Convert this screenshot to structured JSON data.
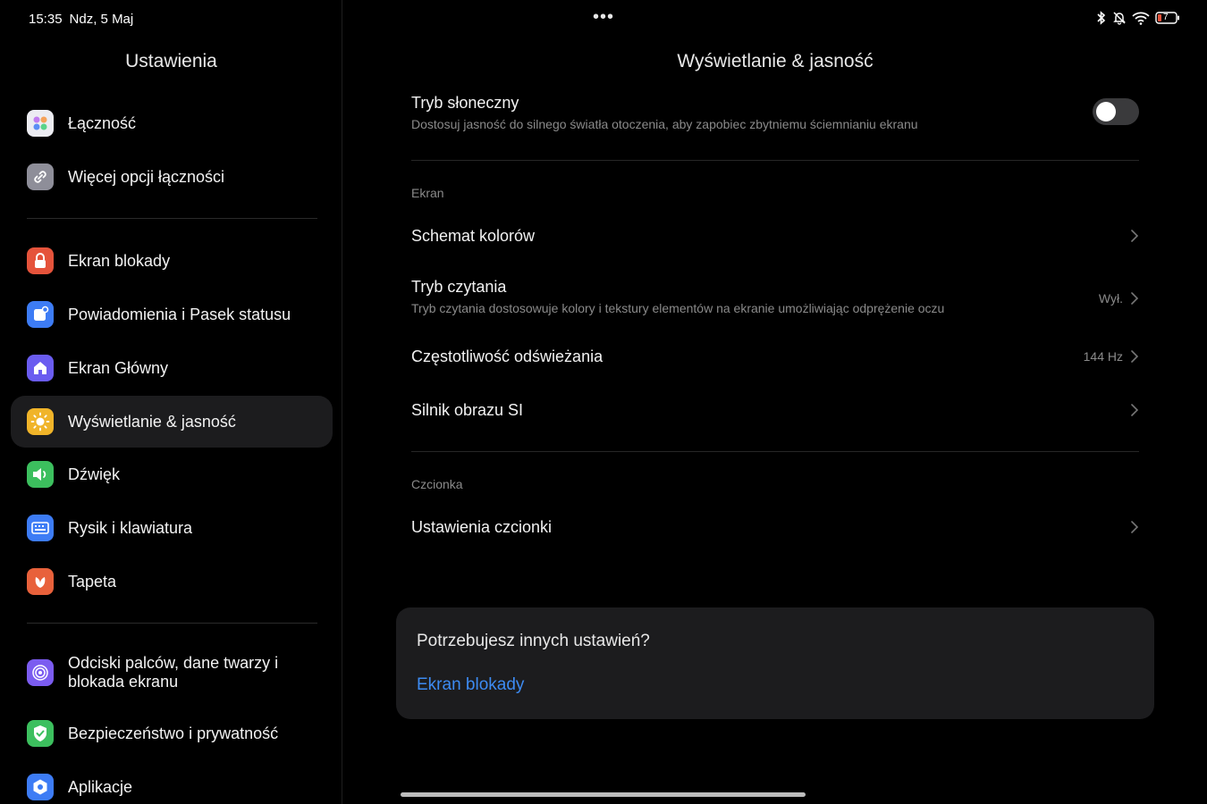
{
  "status_bar": {
    "time": "15:35",
    "date": "Ndz, 5 Maj",
    "more": "•••",
    "battery_level": "7"
  },
  "sidebar": {
    "title": "Ustawienia",
    "items": [
      {
        "label": "Łączność",
        "icon": "connectivity-icon",
        "color": "#e8e8ee"
      },
      {
        "label": "Więcej opcji łączności",
        "icon": "link-icon",
        "color": "#8e8e99"
      },
      {
        "label": "Ekran blokady",
        "icon": "lock-icon",
        "color": "#e5533b"
      },
      {
        "label": "Powiadomienia i Pasek statusu",
        "icon": "notification-icon",
        "color": "#3d7cf5"
      },
      {
        "label": "Ekran Główny",
        "icon": "home-icon",
        "color": "#6a5cf0"
      },
      {
        "label": "Wyświetlanie & jasność",
        "icon": "sun-icon",
        "color": "#f0b429",
        "active": true
      },
      {
        "label": "Dźwięk",
        "icon": "speaker-icon",
        "color": "#3cbf5e"
      },
      {
        "label": "Rysik i klawiatura",
        "icon": "keyboard-icon",
        "color": "#3d7cf5"
      },
      {
        "label": "Tapeta",
        "icon": "wallpaper-icon",
        "color": "#e8613b"
      },
      {
        "label": "Odciski palców, dane twarzy i blokada ekranu",
        "icon": "fingerprint-icon",
        "color": "#7b5cf0"
      },
      {
        "label": "Bezpieczeństwo i prywatność",
        "icon": "shield-icon",
        "color": "#3cbf5e"
      },
      {
        "label": "Aplikacje",
        "icon": "apps-icon",
        "color": "#3d7cf5"
      }
    ]
  },
  "main": {
    "title": "Wyświetlanie & jasność",
    "sun_mode": {
      "title": "Tryb słoneczny",
      "subtitle": "Dostosuj jasność do silnego światła otoczenia, aby zapobiec zbytniemu ściemnianiu ekranu",
      "enabled": false
    },
    "section_screen": "Ekran",
    "color_scheme": {
      "title": "Schemat kolorów"
    },
    "reading_mode": {
      "title": "Tryb czytania",
      "subtitle": "Tryb czytania dostosowuje kolory i tekstury elementów na ekranie umożliwiając odprężenie oczu",
      "value": "Wył."
    },
    "refresh_rate": {
      "title": "Częstotliwość odświeżania",
      "value": "144 Hz"
    },
    "ai_engine": {
      "title": "Silnik obrazu SI"
    },
    "section_font": "Czcionka",
    "font_settings": {
      "title": "Ustawienia czcionki"
    },
    "card": {
      "title": "Potrzebujesz innych ustawień?",
      "link": "Ekran blokady"
    }
  },
  "colors": {
    "accent": "#3d8bf2",
    "background": "#000000",
    "card": "#1c1c1e"
  }
}
